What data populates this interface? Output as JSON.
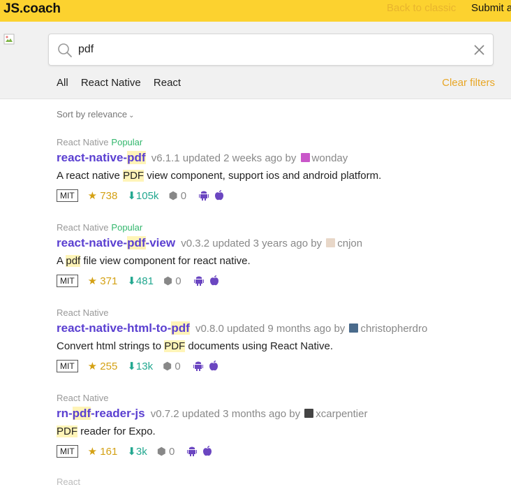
{
  "header": {
    "logo": "JS.coach",
    "back_classic": "Back to classic",
    "submit": "Submit a"
  },
  "search": {
    "value": "pdf",
    "placeholder": ""
  },
  "filters": {
    "tabs": [
      "All",
      "React Native",
      "React"
    ],
    "clear": "Clear filters"
  },
  "sort": {
    "label": "Sort by relevance",
    "chevron": "⌄"
  },
  "results": [
    {
      "category": "React Native",
      "badge": "Popular",
      "name_pre": "react-native-",
      "name_hl": "pdf",
      "name_post": "",
      "version": "v6.1.1 updated 2 weeks ago by",
      "author": "wonday",
      "avatar_color": "#c957c9",
      "desc_pre": "A react native ",
      "desc_hl": "PDF",
      "desc_post": " view component, support ios and android platform.",
      "license": "MIT",
      "stars": "738",
      "downloads": "105k",
      "issues": "0"
    },
    {
      "category": "React Native",
      "badge": "Popular",
      "name_pre": "react-native-",
      "name_hl": "pdf",
      "name_post": "-view",
      "version": "v0.3.2 updated 3 years ago by",
      "author": "cnjon",
      "avatar_color": "#e8d7c8",
      "desc_pre": "A ",
      "desc_hl": "pdf",
      "desc_post": " file view component for react native.",
      "license": "MIT",
      "stars": "371",
      "downloads": "481",
      "issues": "0"
    },
    {
      "category": "React Native",
      "badge": "",
      "name_pre": "react-native-html-to-",
      "name_hl": "pdf",
      "name_post": "",
      "version": "v0.8.0 updated 9 months ago by",
      "author": "christopherdro",
      "avatar_color": "#4a6b8c",
      "desc_pre": "Convert html strings to ",
      "desc_hl": "PDF",
      "desc_post": " documents using React Native.",
      "license": "MIT",
      "stars": "255",
      "downloads": "13k",
      "issues": "0"
    },
    {
      "category": "React Native",
      "badge": "",
      "name_pre": "rn-",
      "name_hl": "pdf",
      "name_post": "-reader-js",
      "version": "v0.7.2 updated 3 months ago by",
      "author": "xcarpentier",
      "avatar_color": "#444444",
      "desc_pre": "",
      "desc_hl": "PDF",
      "desc_post": " reader for Expo.",
      "license": "MIT",
      "stars": "161",
      "downloads": "3k",
      "issues": "0"
    }
  ],
  "next_category_partial": "React",
  "icons": {
    "star": "★",
    "download": "⬇",
    "issue": "⬢"
  },
  "colors": {
    "brand": "#fcd22f",
    "link": "#5a3fd1",
    "popular": "#33b76d",
    "stars": "#d4a114",
    "downloads": "#23a890",
    "platform": "#6b46c1"
  }
}
